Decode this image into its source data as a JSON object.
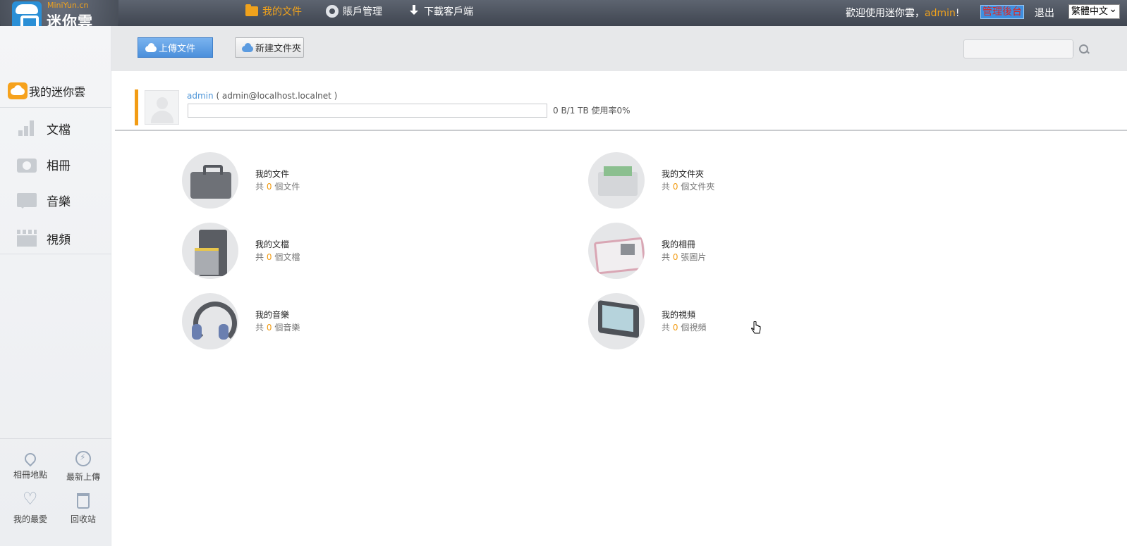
{
  "brand": {
    "name": "迷你雲",
    "subtitle": "MiniYun.cn"
  },
  "top_nav": [
    {
      "label": "我的文件",
      "icon": "folder-icon",
      "active": true
    },
    {
      "label": "賬戶管理",
      "icon": "gear-icon"
    },
    {
      "label": "下載客戶端",
      "icon": "download-icon"
    }
  ],
  "header": {
    "welcome_prefix": "歡迎使用迷你雲，",
    "username": "admin",
    "welcome_suffix": "!",
    "admin_label": "管理後台",
    "logout_label": "退出",
    "language": "繁體中文"
  },
  "sidebar": {
    "title": "我的迷你雲",
    "items": [
      {
        "label": "文檔",
        "icon": "bar-chart-icon"
      },
      {
        "label": "相冊",
        "icon": "camera-icon"
      },
      {
        "label": "音樂",
        "icon": "message-icon"
      },
      {
        "label": "視頻",
        "icon": "clapperboard-icon"
      }
    ],
    "tools": [
      {
        "label": "相冊地點",
        "icon": "location-pin-icon"
      },
      {
        "label": "最新上傳",
        "icon": "lightning-icon"
      },
      {
        "label": "我的最愛",
        "icon": "heart-icon"
      },
      {
        "label": "回收站",
        "icon": "trash-icon"
      }
    ]
  },
  "toolbar": {
    "upload_label": "上傳文件",
    "new_folder_label": "新建文件夾",
    "search_placeholder": ""
  },
  "user": {
    "name": "admin",
    "email_text": "( admin@localhost.localnet )",
    "quota_text": "0 B/1  TB   使用率0%",
    "usage_fraction": 0
  },
  "categories": [
    {
      "title": "我的文件",
      "prefix": "共",
      "count": "0",
      "suffix": "個文件",
      "icon": "briefcase-icon"
    },
    {
      "title": "我的文件夾",
      "prefix": "共",
      "count": "0",
      "suffix": "個文件夾",
      "icon": "file-drawer-icon"
    },
    {
      "title": "我的文檔",
      "prefix": "共",
      "count": "0",
      "suffix": "個文檔",
      "icon": "filing-cabinet-icon"
    },
    {
      "title": "我的相冊",
      "prefix": "共",
      "count": "0",
      "suffix": "張圖片",
      "icon": "photo-album-icon"
    },
    {
      "title": "我的音樂",
      "prefix": "共",
      "count": "0",
      "suffix": "個音樂",
      "icon": "headphones-icon"
    },
    {
      "title": "我的視頻",
      "prefix": "共",
      "count": "0",
      "suffix": "個視頻",
      "icon": "monitor-icon"
    }
  ],
  "colors": {
    "accent": "#f29c14",
    "link": "#4d95d8",
    "topbar": "#4a505b",
    "upload_button": "#4b8fdb"
  }
}
